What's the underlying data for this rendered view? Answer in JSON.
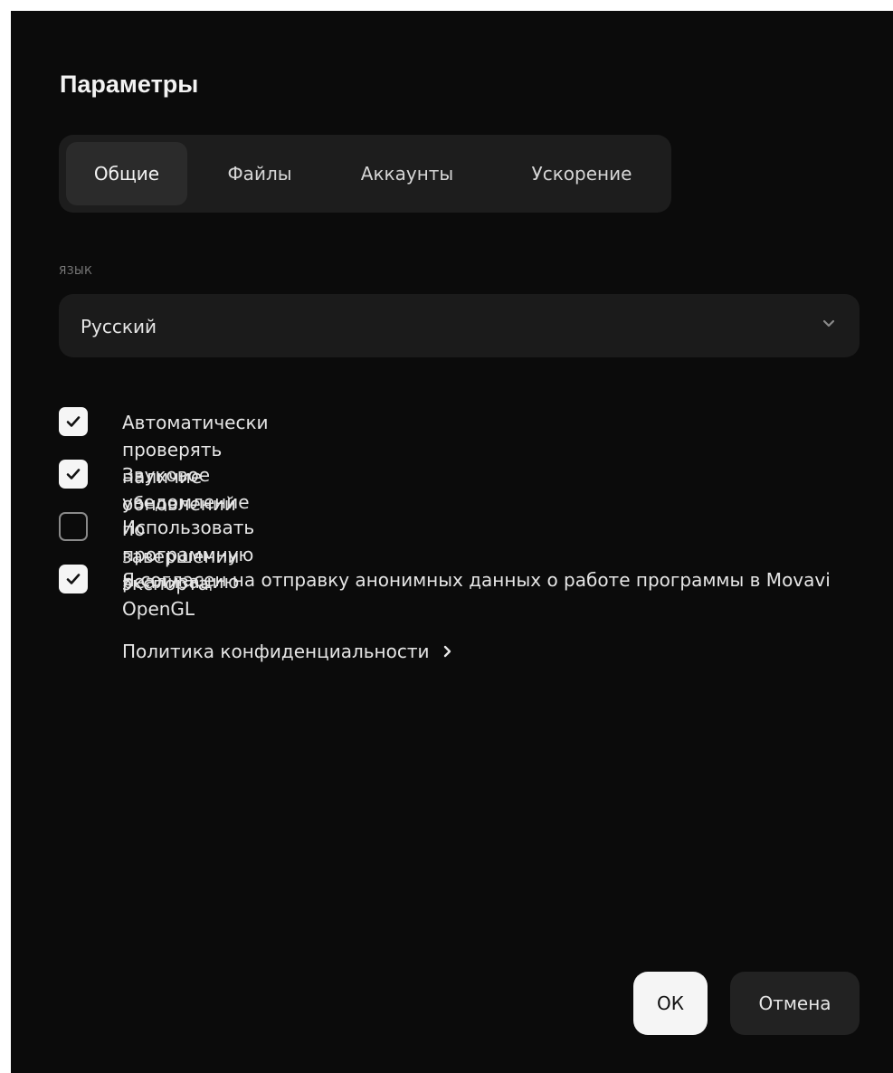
{
  "dialog": {
    "title": "Параметры"
  },
  "tabs": [
    {
      "label": "Общие",
      "active": true
    },
    {
      "label": "Файлы",
      "active": false
    },
    {
      "label": "Аккаунты",
      "active": false
    },
    {
      "label": "Ускорение",
      "active": false
    }
  ],
  "language": {
    "section_label": "ЯЗЫК",
    "selected": "Русский",
    "icon": "chevron-down-icon"
  },
  "options": [
    {
      "label": "Автоматически проверять наличие обновлений",
      "checked": true
    },
    {
      "label": "Звуковое уведомление по завершении экспорта",
      "checked": true
    },
    {
      "label": "Использовать программную реализацию OpenGL",
      "checked": false
    },
    {
      "label": "Я согласен на отправку анонимных данных о работе программы в Movavi",
      "checked": true
    }
  ],
  "privacy_link": {
    "label": "Политика конфиденциальности",
    "icon": "chevron-right-icon"
  },
  "buttons": {
    "ok": "ОК",
    "cancel": "Отмена"
  },
  "colors": {
    "background": "#0b0b0b",
    "panel": "#1d1d1d",
    "checkbox_on": "#f5f5f5",
    "ok_button": "#f5f5f5"
  }
}
